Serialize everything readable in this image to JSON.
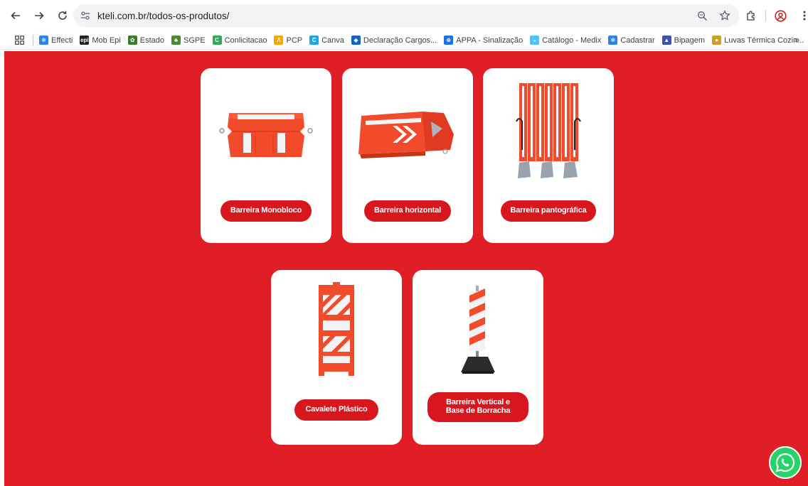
{
  "browser": {
    "url": "kteli.com.br/todos-os-produtos/",
    "bookmarks": [
      {
        "label": "Effecti",
        "icon": "snowflake-icon",
        "color": "#2f80ed"
      },
      {
        "label": "Mob Epi",
        "icon": "epi-icon",
        "color": "#222222"
      },
      {
        "label": "Estado",
        "icon": "state-seal-icon",
        "color": "#3b7d2b"
      },
      {
        "label": "SGPE",
        "icon": "sgpe-icon",
        "color": "#4a8a34"
      },
      {
        "label": "Conlicitacao",
        "icon": "conlicitacao-icon",
        "color": "#34a853"
      },
      {
        "label": "PCP",
        "icon": "pcp-icon",
        "color": "#f7a600"
      },
      {
        "label": "Canva",
        "icon": "canva-icon",
        "color": "#1fa6e0"
      },
      {
        "label": "Declaração Cargos...",
        "icon": "declaracao-icon",
        "color": "#1565c0"
      },
      {
        "label": "APPA - Sinalização",
        "icon": "globe-icon",
        "color": "#1a73e8"
      },
      {
        "label": "Catálogo - Medix",
        "icon": "medix-icon",
        "color": "#4fc3f7"
      },
      {
        "label": "Cadastrar",
        "icon": "snowflake-icon",
        "color": "#2f80ed"
      },
      {
        "label": "Bipagem",
        "icon": "bipagem-icon",
        "color": "#3f51b5"
      },
      {
        "label": "Luvas Térmica Cozin...",
        "icon": "luvas-icon",
        "color": "#c9a227"
      }
    ]
  },
  "products": [
    {
      "label": "Barreira Monobloco",
      "image": "barrier-monobloco-image"
    },
    {
      "label": "Barreira horizontal",
      "image": "barrier-horizontal-image"
    },
    {
      "label": "Barreira pantográfica",
      "image": "barrier-pantografica-image"
    },
    {
      "label": "Cavalete Plástico",
      "image": "cavalete-plastico-image"
    },
    {
      "label": "Barreira Vertical e Base de Borracha",
      "image": "barrier-vertical-image"
    }
  ],
  "colors": {
    "page_background": "#e01e25",
    "button": "#d8161e",
    "card": "#ffffff",
    "whatsapp": "#25d366"
  }
}
